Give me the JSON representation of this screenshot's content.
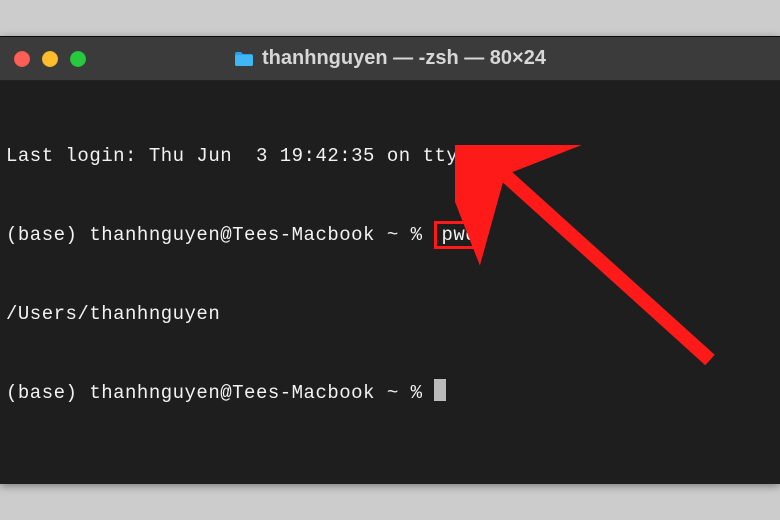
{
  "window": {
    "title": "thanhnguyen — -zsh — 80×24",
    "folder_icon_name": "folder-icon"
  },
  "terminal": {
    "last_login_line": "Last login: Thu Jun  3 19:42:35 on ttys000",
    "prompt1_prefix": "(base) thanhnguyen@Tees-Macbook ~ % ",
    "command1": "pwd",
    "output1": "/Users/thanhnguyen",
    "prompt2_prefix": "(base) thanhnguyen@Tees-Macbook ~ % "
  },
  "colors": {
    "window_bg": "#1e1e1e",
    "titlebar_bg": "#3b3b3b",
    "text": "#f2f2f2",
    "highlight_border": "#ff1a1a",
    "arrow": "#ff1a1a"
  }
}
